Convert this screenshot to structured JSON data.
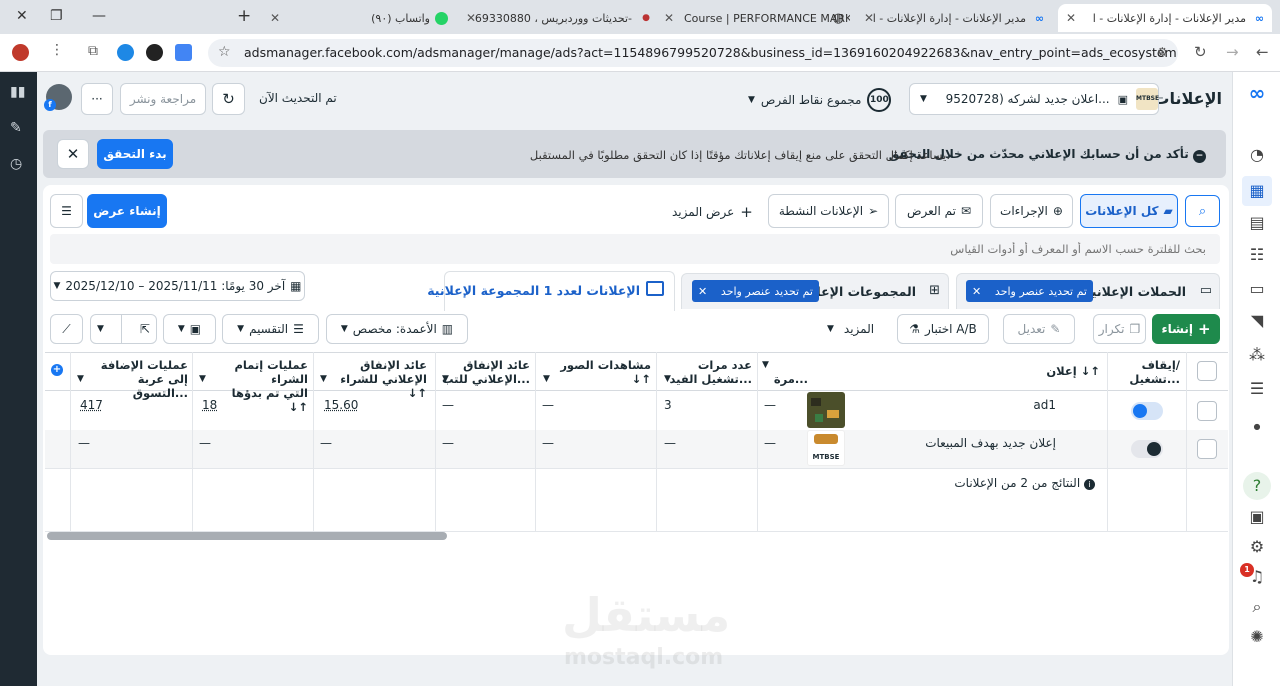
{
  "browser": {
    "tabs": [
      {
        "title": "مدير الإعلانات - إدارة الإعلانات - ا",
        "active": true
      },
      {
        "title": "مدير الإعلانات - إدارة الإعلانات - ا"
      },
      {
        "title": "Course | PERFORMANCE MARK"
      },
      {
        "title": "تحديثات ووردبريس ، 69330880-"
      },
      {
        "title": "(٩٠) واتساب"
      }
    ],
    "url": "adsmanager.facebook.com/adsmanager/manage/ads?act=1154896799520728&business_id=1369160204922683&nav_entry_point=ads_ecosystem_navigation_menu&column..."
  },
  "header": {
    "page_title": "الإعلانات",
    "account_selector": "اعلان جديد لشركه (9520728...",
    "opportunity_score_value": "100",
    "opportunity_score_label": "مجموع نقاط الفرص",
    "updated_label": "تم التحديث الآن",
    "review_publish_label": "مراجعة ونشر",
    "more_label": "···"
  },
  "banner": {
    "title": "تأكد من أن حسابك الإعلاني محدّث من خلال التحقق",
    "message": "يساعد إكمال التحقق على منع إيقاف إعلاناتك مؤقتًا إذا كان التحقق مطلوبًا في المستقبل.",
    "start_verify_label": "بدء التحقق"
  },
  "filters": {
    "all_ads_label": "كل الإعلانات",
    "actions_label": "الإجراءات",
    "delivered_label": "تم العرض",
    "active_ads_label": "الإعلانات النشطة",
    "view_more_label": "عرض المزيد",
    "create_view_label": "إنشاء عرض",
    "search_placeholder": "بحث للفلترة حسب الاسم أو المعرف أو أدوات القياس"
  },
  "level_tabs": {
    "campaigns_label": "الحملات الإعلانية",
    "campaigns_chip": "تم تحديد عنصر واحد",
    "adsets_label": "المجموعات الإعلا",
    "adsets_chip": "تم تحديد عنصر واحد",
    "ads_label": "الإعلانات لعدد 1 المجموعة الإعلانية",
    "date_range": "آخر 30 يومًا: 2025/11/11 – 2025/12/10"
  },
  "toolbar": {
    "create_label": "إنشاء",
    "duplicate_label": "تكرار",
    "edit_label": "تعديل",
    "ab_test_label": "اختبار A/B",
    "more_label": "المزيد",
    "columns_label": "الأعمدة: مخصص",
    "breakdown_label": "التقسيم"
  },
  "table": {
    "columns": [
      {
        "l1": "إيقاف/",
        "l2": "تشغيل..."
      },
      {
        "l1": "إعلان ↓↑",
        "l2": ""
      },
      {
        "l1": "",
        "l2": "مرة..."
      },
      {
        "l1": "عدد مرات",
        "l2": "تشغيل الفيد..."
      },
      {
        "l1": "مشاهدات الصور",
        "l2": "↓↑"
      },
      {
        "l1": "عائد الإنفاق",
        "l2": "الإعلاني للتب..."
      },
      {
        "l1": "عائد الإنفاق",
        "l2": "الإعلاني للشراء ↓↑"
      },
      {
        "l1": "عمليات إتمام الشراء",
        "l2": "التي تم بدؤها ↓↑"
      },
      {
        "l1": "عمليات الإضافة",
        "l2": "إلى عربة التسوق..."
      }
    ],
    "rows": [
      {
        "name": "ad1",
        "on": true,
        "c3": "—",
        "c4": "3",
        "c5": "—",
        "c6": "—",
        "c7": "15.60",
        "c8": "18",
        "c9": "417"
      },
      {
        "name": "إعلان جديد بهدف المبيعات",
        "on": false,
        "c3": "—",
        "c4": "—",
        "c5": "—",
        "c6": "—",
        "c7": "—",
        "c8": "—",
        "c9": "—"
      }
    ],
    "results_label": "النتائج من 2 من الإعلانات"
  },
  "thumb_brand": "MTBSE",
  "right_nav": {
    "notification_count": "1"
  },
  "watermark": {
    "arabic": "مستقل",
    "latin": "mostaql.com"
  },
  "colors": {
    "accent": "#1877f2",
    "create_green": "#1e8a4c",
    "left_rail": "#1f2a33"
  }
}
